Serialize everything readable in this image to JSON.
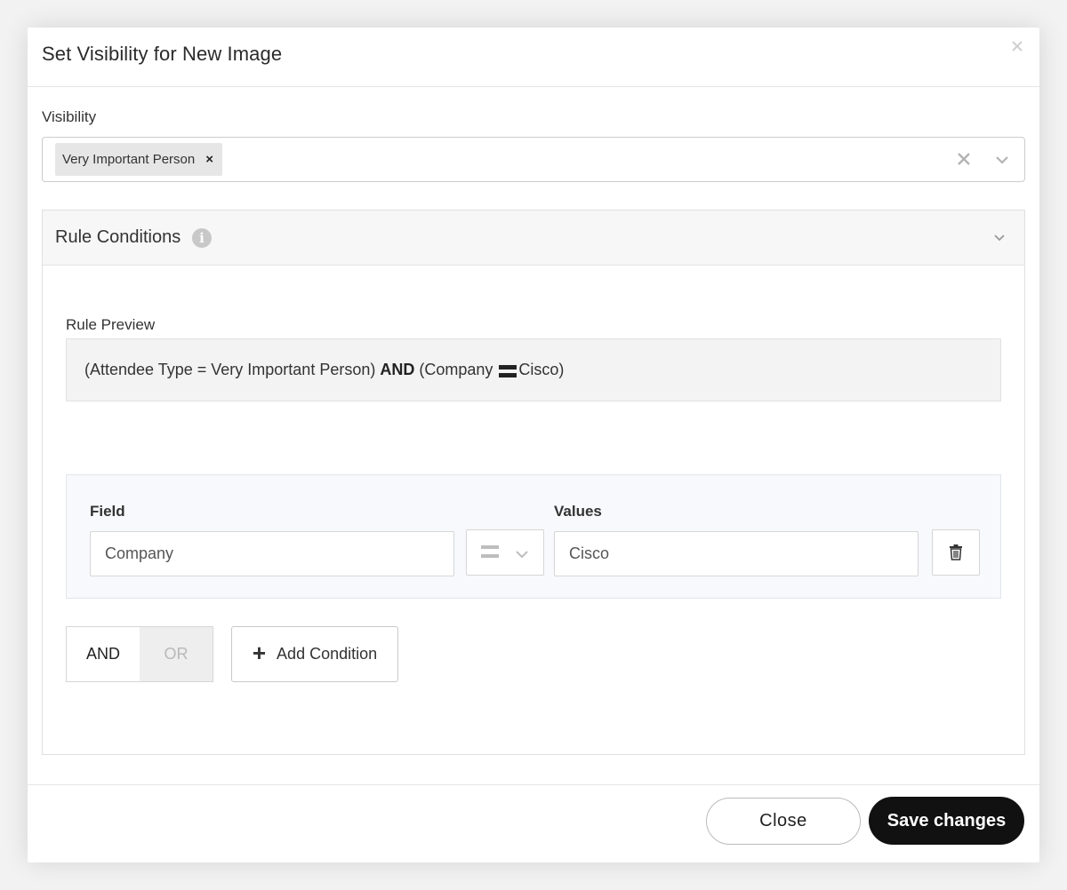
{
  "modal": {
    "title": "Set Visibility for New Image",
    "close_icon": "close-icon"
  },
  "visibility": {
    "label": "Visibility",
    "selected": [
      "Very Important Person"
    ],
    "chip_remove": "×"
  },
  "rule_conditions": {
    "title": "Rule Conditions",
    "info_icon": "i",
    "preview_label": "Rule Preview",
    "preview": {
      "part1": "(Attendee Type = Very Important Person) ",
      "operator": "AND",
      "part2_prefix": " (Company ",
      "part2_suffix": "Cisco)"
    },
    "condition": {
      "field_label": "Field",
      "field_value": "Company",
      "values_label": "Values",
      "values_value": "Cisco"
    },
    "logic": {
      "and_label": "AND",
      "or_label": "OR",
      "active": "AND"
    },
    "add_condition_label": "Add Condition",
    "add_condition_icon": "+"
  },
  "footer": {
    "close_label": "Close",
    "save_label": "Save changes"
  }
}
